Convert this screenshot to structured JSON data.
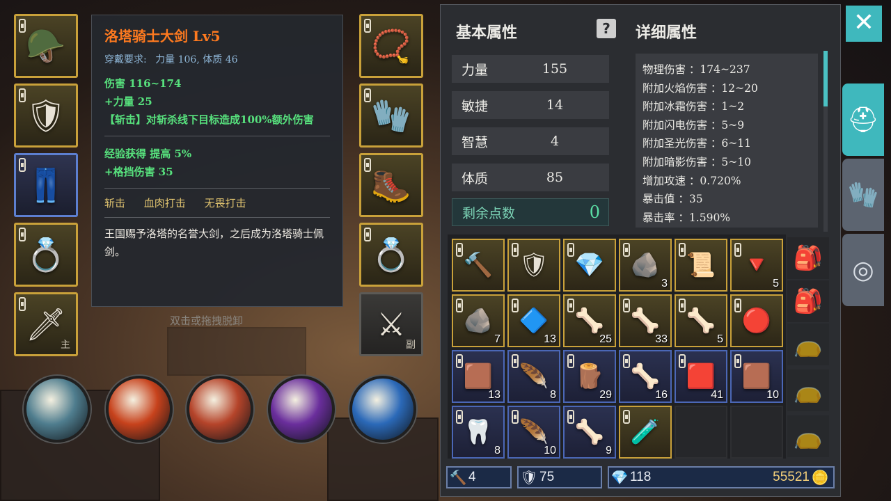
{
  "tooltip": {
    "title": "洛塔骑士大剑 Lv5",
    "req_label": "穿戴要求:",
    "req_values": "力量 106, 体质 46",
    "lines_a": [
      "伤害 116~174",
      "+力量 25",
      "【斩击】对斩杀线下目标造成100%额外伤害"
    ],
    "lines_b": [
      "经验获得 提高 5%",
      "+格挡伤害 35"
    ],
    "tags": [
      "斩击",
      "血肉打击",
      "无畏打击"
    ],
    "desc": "王国赐予洛塔的名誉大剑，之后成为洛塔骑士佩剑。"
  },
  "hint": "双击或拖拽脱卸",
  "equip": {
    "left": [
      {
        "icon": "helmet",
        "glyph": "🪖"
      },
      {
        "icon": "chest-armor",
        "glyph": "🛡"
      },
      {
        "icon": "leg-armor",
        "glyph": "👖"
      },
      {
        "icon": "ring",
        "glyph": "💍"
      },
      {
        "icon": "greatsword",
        "glyph": "🗡",
        "tag": "主"
      }
    ],
    "right": [
      {
        "icon": "amulet",
        "glyph": "📿"
      },
      {
        "icon": "gauntlet",
        "glyph": "🧤"
      },
      {
        "icon": "boots",
        "glyph": "🥾"
      },
      {
        "icon": "ring",
        "glyph": "💍"
      },
      {
        "icon": "offhand-sword",
        "glyph": "⚔",
        "tag": "副"
      }
    ]
  },
  "skills": [
    {
      "icon": "blade-strike",
      "color": "#4f7d8e"
    },
    {
      "icon": "fire-slash",
      "color": "#c7421c"
    },
    {
      "icon": "blood-cleave",
      "color": "#b5442a"
    },
    {
      "icon": "shadow-spin",
      "color": "#6a2e9c"
    },
    {
      "icon": "dash",
      "color": "#2b69b8"
    }
  ],
  "stats": {
    "basic_title": "基本属性",
    "detail_title": "详细属性",
    "help": "?",
    "rows": [
      {
        "label": "力量",
        "value": "155"
      },
      {
        "label": "敏捷",
        "value": "14"
      },
      {
        "label": "智慧",
        "value": "4"
      },
      {
        "label": "体质",
        "value": "85"
      }
    ],
    "remaining_label": "剩余点数",
    "remaining_value": "0",
    "details": [
      "物理伤害 ：174~237",
      "附加火焰伤害 ：12~20",
      "附加冰霜伤害 ：1~2",
      "附加闪电伤害 ：5~9",
      "附加圣光伤害 ：6~11",
      "附加暗影伤害 ：5~10",
      "增加攻速 ：0.720%",
      "暴击值 ：35",
      "暴击率 ：1.590%"
    ]
  },
  "inventory": [
    {
      "icon": "mace",
      "glyph": "🔨",
      "qty": "",
      "tier": "gold"
    },
    {
      "icon": "pauldron",
      "glyph": "🛡",
      "qty": "",
      "tier": "gold"
    },
    {
      "icon": "purple-gem",
      "glyph": "💎",
      "qty": "",
      "tier": "gold"
    },
    {
      "icon": "crystal-ore",
      "glyph": "🪨",
      "qty": "3",
      "tier": "gold"
    },
    {
      "icon": "scroll",
      "glyph": "📜",
      "qty": "",
      "tier": "gold"
    },
    {
      "icon": "red-crystal",
      "glyph": "🔻",
      "qty": "5",
      "tier": "gold"
    },
    {
      "icon": "red-ore",
      "glyph": "🪨",
      "qty": "7",
      "tier": "gold"
    },
    {
      "icon": "dark-shard",
      "glyph": "🔷",
      "qty": "13",
      "tier": "gold"
    },
    {
      "icon": "claw",
      "glyph": "🦴",
      "qty": "25",
      "tier": "gold"
    },
    {
      "icon": "horn",
      "glyph": "🦴",
      "qty": "33",
      "tier": "gold"
    },
    {
      "icon": "spine",
      "glyph": "🦴",
      "qty": "5",
      "tier": "gold"
    },
    {
      "icon": "red-heart",
      "glyph": "🔴",
      "qty": "",
      "tier": "gold"
    },
    {
      "icon": "hide",
      "glyph": "🟫",
      "qty": "13",
      "tier": "blue"
    },
    {
      "icon": "feather",
      "glyph": "🪶",
      "qty": "8",
      "tier": "blue"
    },
    {
      "icon": "wood-shard",
      "glyph": "🪵",
      "qty": "29",
      "tier": "blue"
    },
    {
      "icon": "talons",
      "glyph": "🦴",
      "qty": "16",
      "tier": "blue"
    },
    {
      "icon": "red-leather",
      "glyph": "🟥",
      "qty": "41",
      "tier": "blue"
    },
    {
      "icon": "fur-chunk",
      "glyph": "🟫",
      "qty": "10",
      "tier": "blue"
    },
    {
      "icon": "fangs",
      "glyph": "🦷",
      "qty": "8",
      "tier": "blue"
    },
    {
      "icon": "quills",
      "glyph": "🪶",
      "qty": "10",
      "tier": "blue"
    },
    {
      "icon": "bone",
      "glyph": "🦴",
      "qty": "9",
      "tier": "blue"
    },
    {
      "icon": "purple-potion",
      "glyph": "🧪",
      "qty": "",
      "tier": "gold"
    },
    {
      "icon": "",
      "glyph": "",
      "qty": "",
      "tier": "empty"
    },
    {
      "icon": "",
      "glyph": "",
      "qty": "",
      "tier": "empty"
    }
  ],
  "bags": [
    {
      "icon": "backpack",
      "glyph": "🎒"
    },
    {
      "icon": "backpack",
      "glyph": "🎒"
    },
    {
      "icon": "small-pouch",
      "glyph": "👝"
    },
    {
      "icon": "pouch",
      "glyph": "👝"
    },
    {
      "icon": "pouch",
      "glyph": "👝"
    }
  ],
  "currency": {
    "hammer": "4",
    "shield": "75",
    "crystal": "118",
    "gold": "55521"
  },
  "tabs": {
    "close": "✕",
    "gear": "⛑",
    "gloves": "🧤",
    "target": "◎"
  }
}
